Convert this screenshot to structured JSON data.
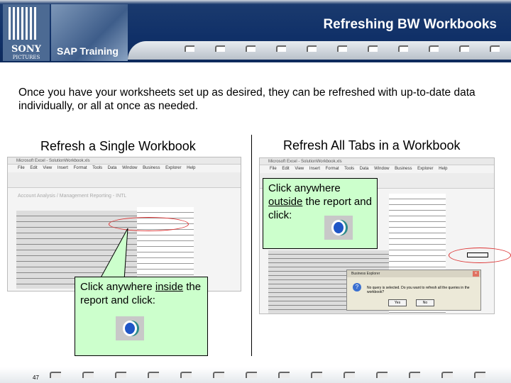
{
  "header": {
    "title": "Refreshing BW Workbooks",
    "brand_top": "SONY",
    "brand_bottom": "PICTURES",
    "product": "SAP Training"
  },
  "intro": "Once you have your worksheets set up as desired, they can be refreshed with up-to-date data individually, or all at once as needed.",
  "left": {
    "heading": "Refresh a Single Workbook",
    "excel_title": "Microsoft Excel - SolutionWorkbook.xls",
    "menu": "File Edit View Insert Format Tools Data Window Business Explorer Help",
    "report_title": "Account Analysis / Management Reporting - INTL",
    "callout_prefix": "Click anywhere ",
    "callout_emph": "inside",
    "callout_suffix": " the report and click:",
    "icon": "refresh-all-icon"
  },
  "right": {
    "heading": "Refresh All Tabs in a Workbook",
    "excel_title": "Microsoft Excel - SolutionWorkbook.xls",
    "menu": "File Edit View Insert Format Tools Data Window Business Explorer Help",
    "callout_prefix": "Click anywhere ",
    "callout_emph": "outside",
    "callout_suffix": " the report and click:",
    "dialog": {
      "title": "Business Explorer",
      "message": "No query is selected. Do you want to refresh all the queries in the workbook?",
      "yes": "Yes",
      "no": "No"
    }
  },
  "footer": {
    "page": "47"
  }
}
